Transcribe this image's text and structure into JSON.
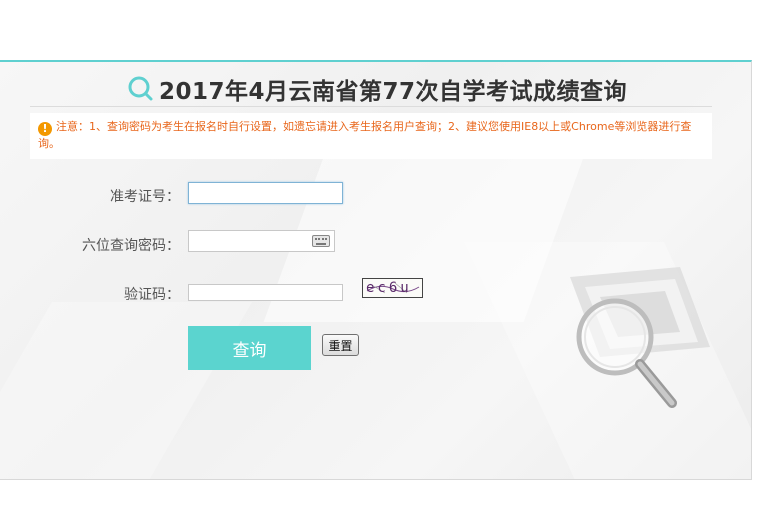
{
  "header": {
    "title": "2017年4月云南省第77次自学考试成绩查询"
  },
  "notice": {
    "text": "注意：1、查询密码为考生在报名时自行设置，如遗忘请进入考生报名用户查询；2、建议您使用IE8以上或Chrome等浏览器进行查询。"
  },
  "form": {
    "admission_label": "准考证号：",
    "admission_value": "",
    "password_label": "六位查询密码：",
    "password_value": "",
    "captcha_label": "验证码：",
    "captcha_value": "",
    "captcha_image_text": "ec6u"
  },
  "buttons": {
    "query_label": "查询",
    "reset_label": "重置"
  },
  "colors": {
    "accent": "#5bd4cf",
    "notice": "#e8661b",
    "warning_icon": "#f39800"
  }
}
